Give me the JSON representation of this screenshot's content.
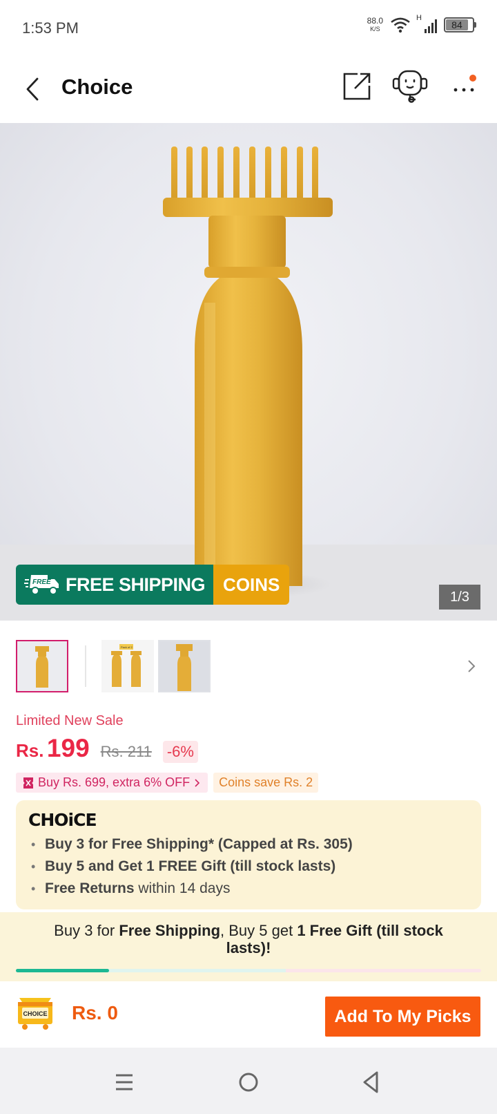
{
  "status_bar": {
    "time": "1:53 PM",
    "net_speed": "88.0",
    "net_unit": "K/S",
    "network_type": "H",
    "battery": "84"
  },
  "header": {
    "title": "Choice"
  },
  "hero": {
    "free_shipping_label": "FREE SHIPPING",
    "free_badge": "FREE",
    "coins_label": "COINS",
    "image_counter": "1/3"
  },
  "thumbnails": {
    "count": 3,
    "active_index": 0,
    "second_thumb_tag": "Pack of 2"
  },
  "price": {
    "sale_label": "Limited New Sale",
    "currency": "Rs.",
    "current": "199",
    "original": "Rs. 211",
    "discount": "-6%"
  },
  "promos": {
    "store_deal": "Buy Rs. 699, extra 6% OFF",
    "coins": "Coins save Rs. 2"
  },
  "choice": {
    "logo": "CHOiCE",
    "items": [
      {
        "bold": "Buy 3 for  Free Shipping* (Capped at Rs. 305)",
        "rest": ""
      },
      {
        "bold": "Buy 5 and Get 1 FREE Gift (till stock lasts)",
        "rest": ""
      },
      {
        "bold": "Free Returns",
        "rest": " within 14 days"
      }
    ]
  },
  "buy_banner": {
    "part1": "Buy 3 for ",
    "part2": "Free Shipping",
    "part3": ", Buy 5 get ",
    "part4": "1 Free Gift (till stock lasts)!",
    "progress": 0.2
  },
  "action_bar": {
    "cart_badge": "CHOICE",
    "total": "Rs. 0",
    "add_button": "Add To My Picks"
  },
  "colors": {
    "accent": "#f85a10",
    "price": "#ea2746",
    "free_shipping_green": "#0b7a5e",
    "coins_gold": "#e9a30d",
    "choice_bg": "#fcf3d6"
  }
}
